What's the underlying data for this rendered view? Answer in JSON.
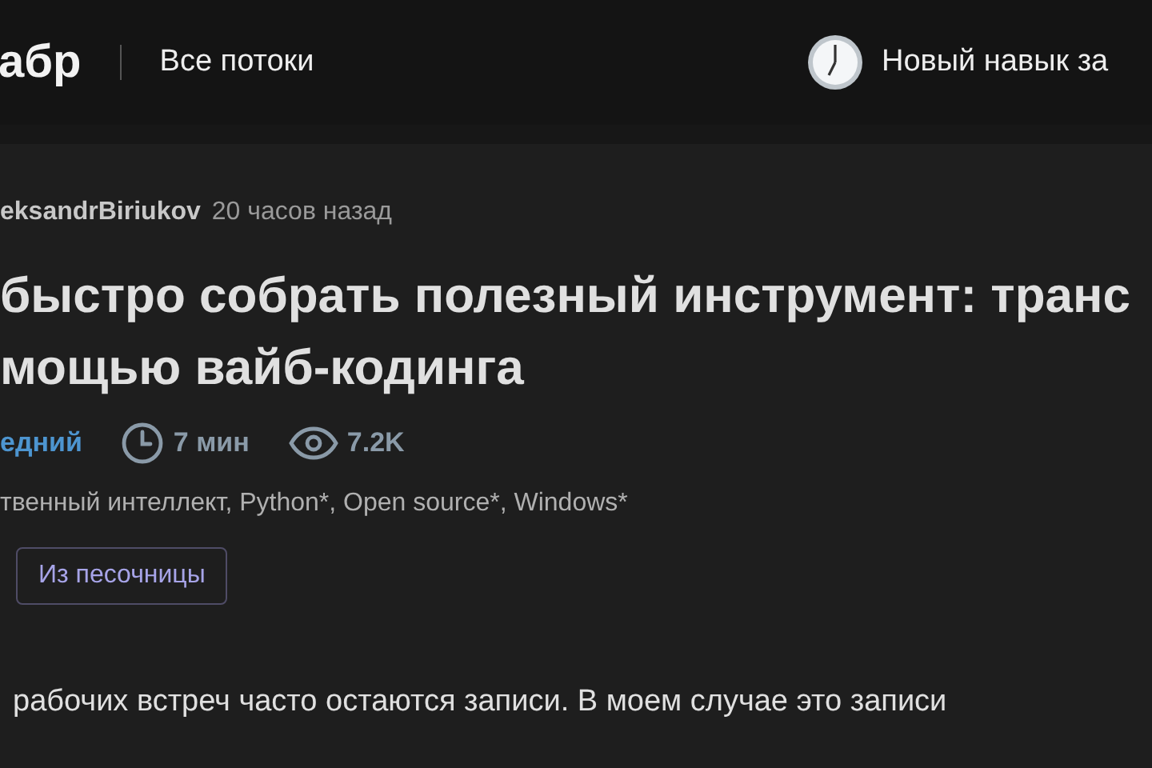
{
  "header": {
    "logo": "абр",
    "nav_link": "Все потоки",
    "promo": "Новый навык за"
  },
  "article": {
    "author": "eksandrBiriukov",
    "time": "20 часов назад",
    "title_lines": [
      "быстро собрать полезный инструмент: транс",
      "мощью вайб-кодинга"
    ],
    "difficulty": "едний",
    "reading_time": "7 мин",
    "views": "7.2K",
    "hubs": "твенный интеллект, Python*, Open source*, Windows*",
    "badge": "Из песочницы",
    "body": "рабочих встреч часто остаются записи. В моем случае это записи"
  }
}
